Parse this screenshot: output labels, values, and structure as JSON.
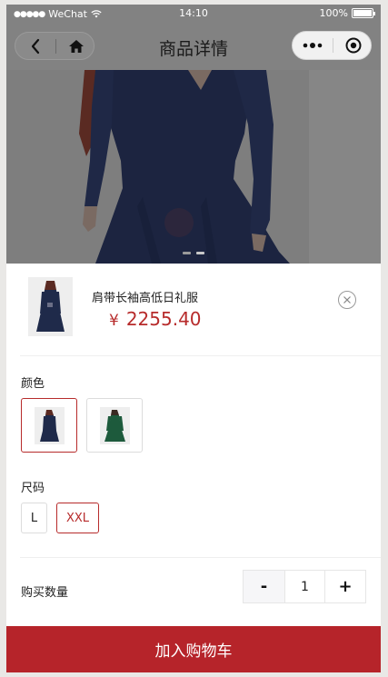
{
  "status_bar": {
    "carrier": "WeChat",
    "signal_dots": "●●●●●",
    "time": "14:10",
    "battery": "100%"
  },
  "nav": {
    "title": "商品详情"
  },
  "hero": {
    "slide_count": 2,
    "active_slide": 2
  },
  "product": {
    "name": "肩带长袖高低日礼服",
    "currency": "¥",
    "price": "2255.40"
  },
  "color": {
    "label": "颜色",
    "options": [
      {
        "name": "navy",
        "swatch": "#1f2a4a",
        "selected": true
      },
      {
        "name": "green",
        "swatch": "#1d5a3c",
        "selected": false
      }
    ]
  },
  "size": {
    "label": "尺码",
    "options": [
      {
        "label": "L",
        "selected": false
      },
      {
        "label": "XXL",
        "selected": true
      }
    ]
  },
  "quantity": {
    "label": "购买数量",
    "minus": "-",
    "value": "1",
    "plus": "+"
  },
  "add_to_cart": "加入购物车",
  "colors": {
    "accent": "#b6242a",
    "dress_navy": "#1c2440",
    "dress_green": "#1d5a3c"
  }
}
